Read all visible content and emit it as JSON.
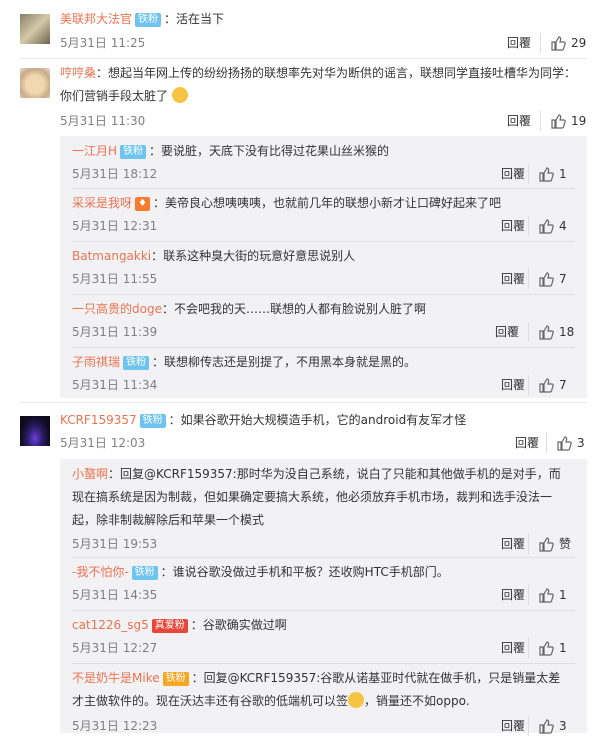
{
  "comments": [
    {
      "user": "美联邦大法官",
      "badge": "铁粉",
      "text": "：活在当下",
      "time": "5月31日 11:25",
      "reply": "回覆",
      "likes": "29"
    },
    {
      "user": "哼哼桑",
      "text1": "：想起当年网上传的纷纷扬扬的联想率先对华为断供的谣言，联想同学直接吐槽华为同学：",
      "text2": "你们营销手段太脏了",
      "time": "5月31日 11:30",
      "reply": "回覆",
      "likes": "19",
      "replies": [
        {
          "user": "一江月H",
          "badge": "铁粉",
          "text": "：要说脏，天底下没有比得过花果山丝米猴的",
          "time": "5月31日 18:12",
          "reply": "回覆",
          "likes": "1"
        },
        {
          "user": "采采是我呀",
          "text": "：美帝良心想咦咦咦，也就前几年的联想小新才让口碑好起来了吧",
          "time": "5月31日 12:31",
          "reply": "回覆",
          "likes": "4"
        },
        {
          "user": "Batmangakki",
          "text": "：联系这种臭大街的玩意好意思说别人",
          "time": "5月31日 11:55",
          "reply": "回覆",
          "likes": "7"
        },
        {
          "user": "一只高贵的doge",
          "text": "：不会吧我的天……联想的人都有脸说别人脏了啊",
          "time": "5月31日 11:39",
          "reply": "回覆",
          "likes": "18"
        },
        {
          "user": "子雨祺瑞",
          "badge": "铁粉",
          "text": "：联想柳传志还是别提了，不用黑本身就是黑的。",
          "time": "5月31日 11:34",
          "reply": "回覆",
          "likes": "7"
        }
      ]
    },
    {
      "user": "KCRF159357",
      "badge": "铁粉",
      "text": "：如果谷歌开始大规模造手机，它的android有友军才怪",
      "time": "5月31日 12:03",
      "reply": "回覆",
      "likes": "3",
      "replies": [
        {
          "user": "小螯啊",
          "text1": "：回复@KCRF159357:那时华为没自己系统，说白了只能和其他做手机的是对手，而",
          "text2": "现在搞系统是因为制裁，但如果确定要搞大系统，他必须放弃手机市场，裁判和选手没法一",
          "text3": "起，除非制裁解除后和苹果一个模式",
          "time": "5月31日 19:53",
          "reply": "回覆",
          "likes": "赞"
        },
        {
          "user": "-我不怕你-",
          "badge": "铁粉",
          "text": "：谁说谷歌没做过手机和平板？还收购HTC手机部门。",
          "time": "5月31日 14:35",
          "reply": "回覆",
          "likes": "1"
        },
        {
          "user": "cat1226_sg5",
          "badge": "真爱粉",
          "text": "：谷歌确实做过啊",
          "time": "5月31日 12:27",
          "reply": "回覆",
          "likes": "1"
        },
        {
          "user": "不是奶牛是Mike",
          "badge": "铁粉",
          "text1": "：回复@KCRF159357:谷歌从诺基亚时代就在做手机，只是销量太差",
          "text2": "才主做软件的。现在沃达丰还有谷歌的低端机可以签",
          "text3": "，销量还不如oppo.",
          "time": "5月31日 12:23",
          "reply": "回覆",
          "likes": "3"
        }
      ]
    }
  ]
}
